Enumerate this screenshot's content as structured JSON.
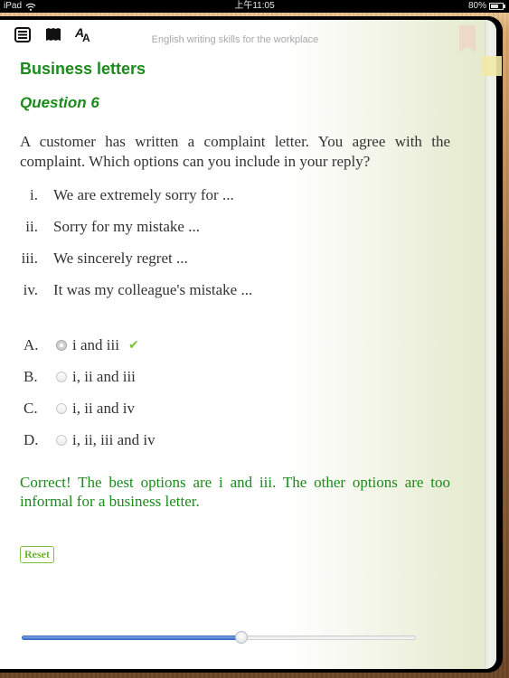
{
  "status_bar": {
    "device": "iPad",
    "time": "上午11:05",
    "battery": "80%",
    "battery_fraction": 0.8
  },
  "toolbar": {
    "icons": [
      "table-of-contents-icon",
      "bookmarks-icon",
      "font-size-icon"
    ]
  },
  "header": {
    "title": "English writing skills for the workplace"
  },
  "main": {
    "section_title": "Business letters",
    "question_title": "Question 6",
    "prompt": "A customer has written a complaint letter. You agree with the complaint. Which options can you include in your reply?",
    "statements": [
      {
        "num": "i.",
        "text": "We are extremely sorry for ..."
      },
      {
        "num": "ii.",
        "text": "Sorry for my mistake ..."
      },
      {
        "num": "iii.",
        "text": "We sincerely regret ..."
      },
      {
        "num": "iv.",
        "text": "It was my colleague's mistake ..."
      }
    ],
    "options": [
      {
        "letter": "A.",
        "text": "i and iii",
        "selected": true,
        "correct_mark": "✔"
      },
      {
        "letter": "B.",
        "text": "i, ii and iii",
        "selected": false
      },
      {
        "letter": "C.",
        "text": "i, ii and iv",
        "selected": false
      },
      {
        "letter": "D.",
        "text": "i, ii, iii and iv",
        "selected": false
      }
    ],
    "feedback": "Correct! The best options are i and iii. The other options are too informal for a business letter.",
    "reset_label": "Reset"
  },
  "page_slider": {
    "progress": 0.557
  },
  "colors": {
    "heading_green": "#1b8a1b",
    "check_green": "#7cc23c",
    "slider_blue": "#3a74cf"
  }
}
